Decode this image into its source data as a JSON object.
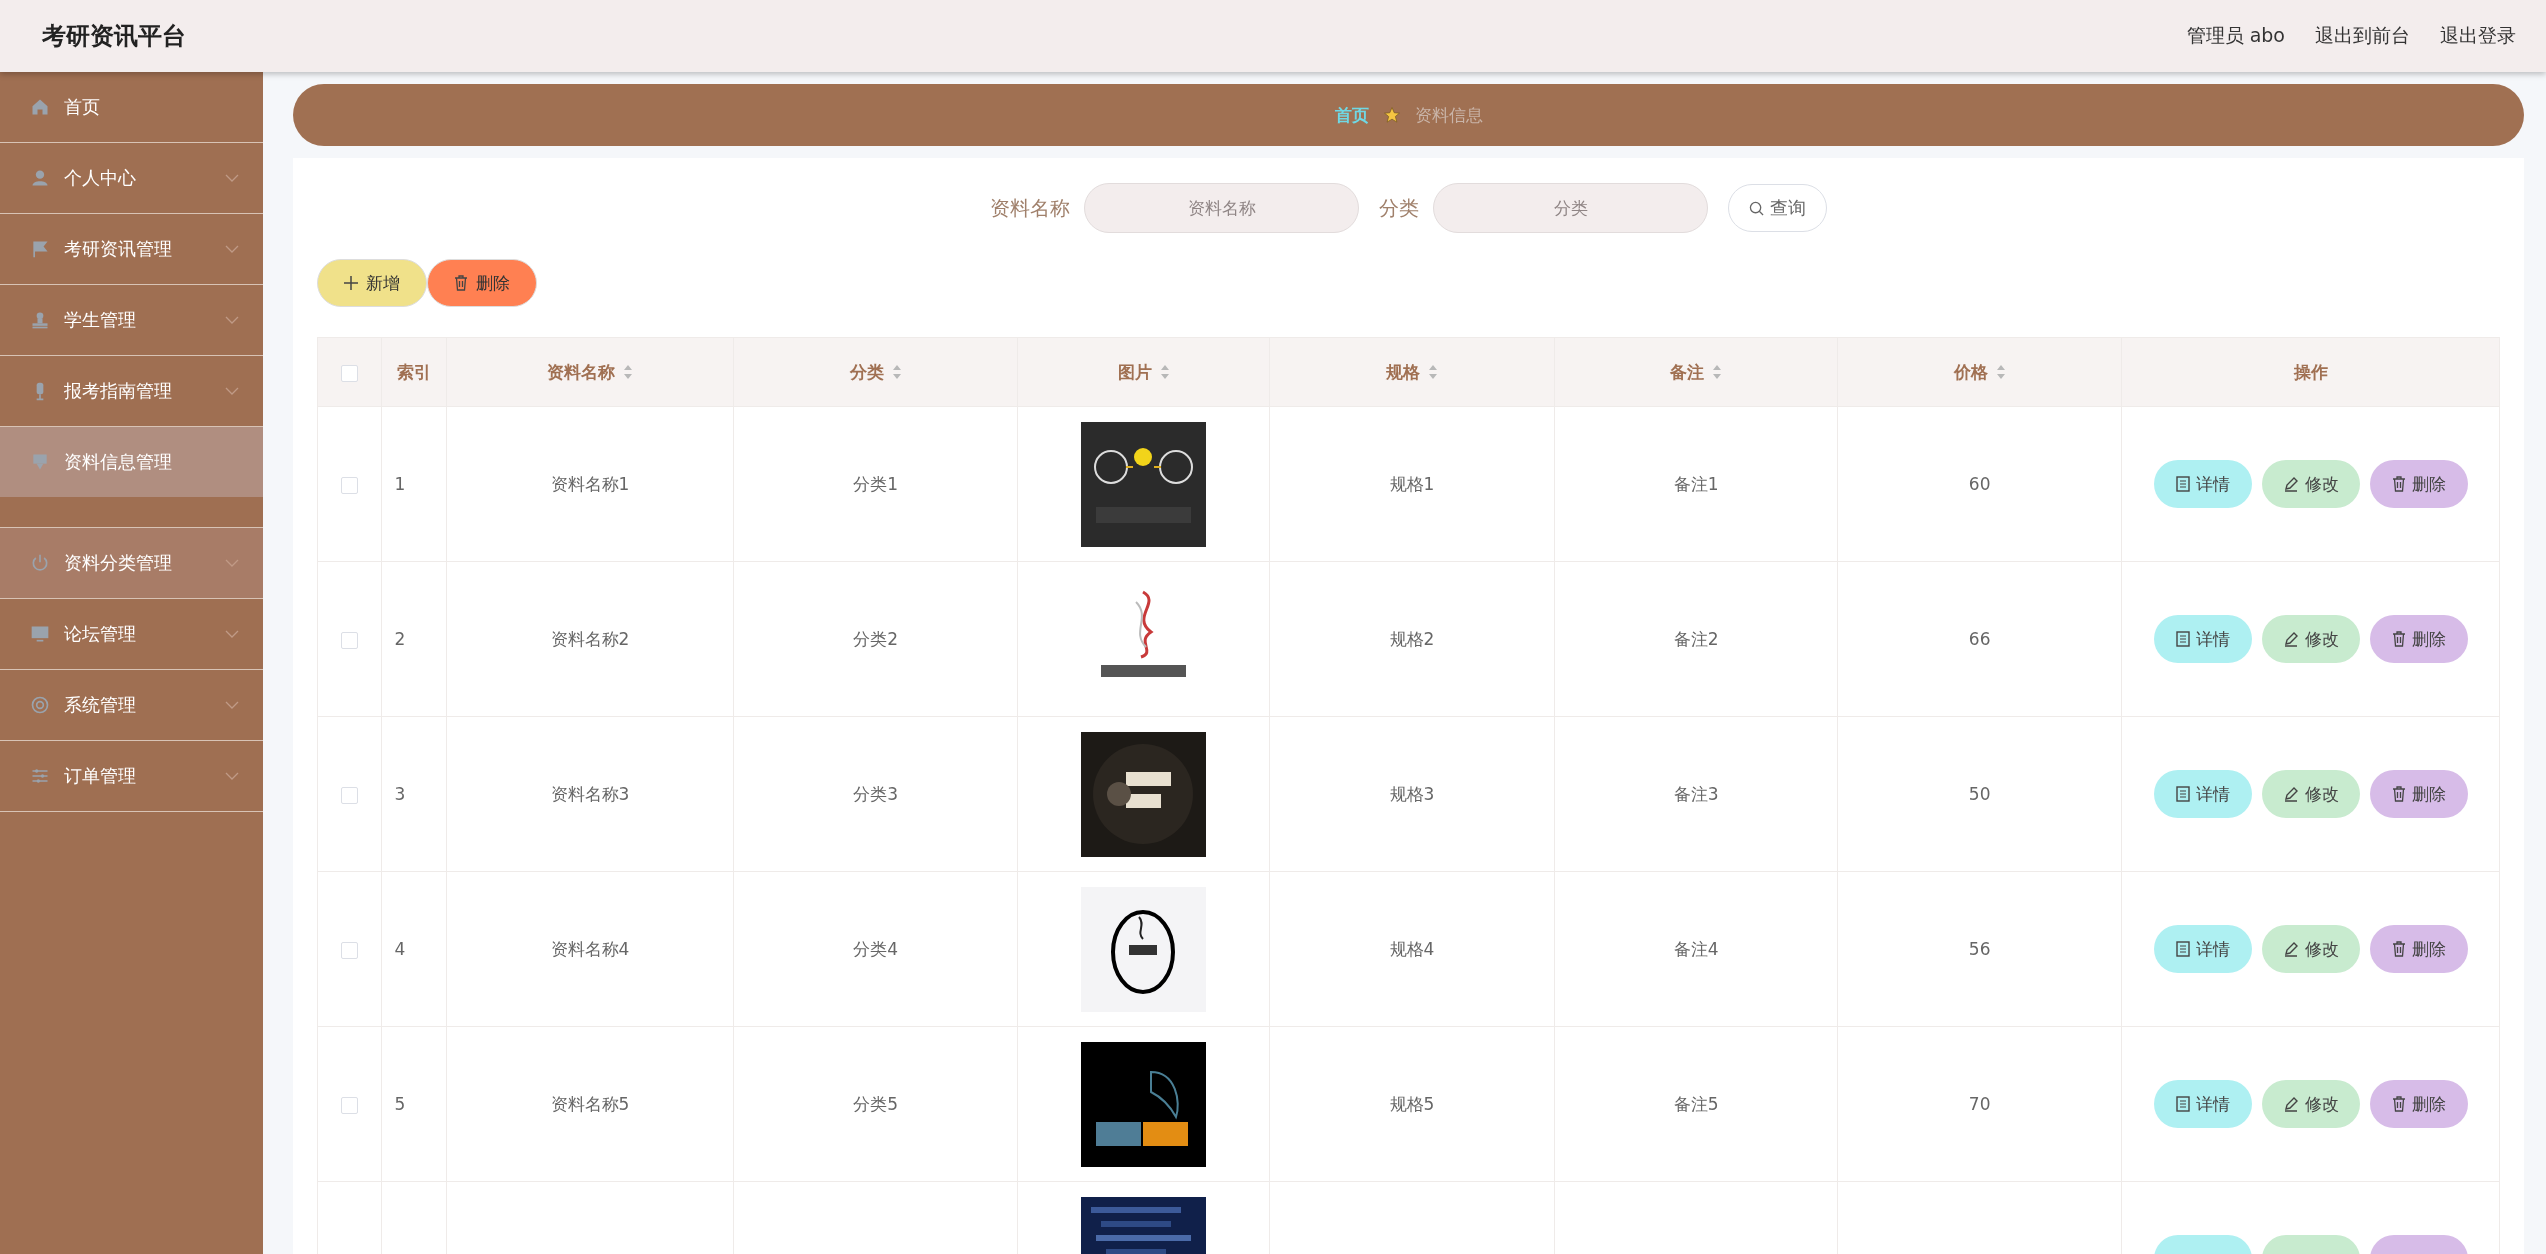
{
  "header": {
    "title": "考研资讯平台",
    "links": [
      {
        "label": "管理员 abo"
      },
      {
        "label": "退出到前台"
      },
      {
        "label": "退出登录"
      }
    ]
  },
  "sidebar": {
    "items": [
      {
        "label": "首页",
        "expandable": false,
        "selected": false,
        "hovered": false,
        "expanded": false
      },
      {
        "label": "个人中心",
        "expandable": true,
        "selected": false,
        "hovered": false,
        "expanded": false
      },
      {
        "label": "考研资讯管理",
        "expandable": true,
        "selected": false,
        "hovered": false,
        "expanded": false
      },
      {
        "label": "学生管理",
        "expandable": true,
        "selected": false,
        "hovered": false,
        "expanded": false
      },
      {
        "label": "报考指南管理",
        "expandable": true,
        "selected": false,
        "hovered": false,
        "expanded": false
      },
      {
        "label": "资料信息管理",
        "expandable": false,
        "selected": true,
        "hovered": false,
        "expanded": true
      },
      {
        "label": "资料分类管理",
        "expandable": true,
        "selected": false,
        "hovered": true,
        "expanded": false
      },
      {
        "label": "论坛管理",
        "expandable": true,
        "selected": false,
        "hovered": false,
        "expanded": false
      },
      {
        "label": "系统管理",
        "expandable": true,
        "selected": false,
        "hovered": false,
        "expanded": false
      },
      {
        "label": "订单管理",
        "expandable": true,
        "selected": false,
        "hovered": false,
        "expanded": false
      }
    ]
  },
  "breadcrumb": [
    {
      "label": "首页",
      "current": false
    },
    {
      "label": "资料信息",
      "current": true
    }
  ],
  "search": {
    "fields": [
      {
        "label": "资料名称",
        "placeholder": "资料名称"
      },
      {
        "label": "分类",
        "placeholder": "分类"
      }
    ],
    "button": "查询"
  },
  "toolbar": [
    {
      "kind": "add",
      "label": "新增"
    },
    {
      "kind": "delete",
      "label": "删除"
    }
  ],
  "table": {
    "select_all": {
      "checked": false
    },
    "columns": [
      {
        "label": "索引",
        "sortable": false
      },
      {
        "label": "资料名称",
        "sortable": true
      },
      {
        "label": "分类",
        "sortable": true
      },
      {
        "label": "图片",
        "sortable": true
      },
      {
        "label": "规格",
        "sortable": true
      },
      {
        "label": "备注",
        "sortable": true
      },
      {
        "label": "价格",
        "sortable": true
      },
      {
        "label": "操作",
        "sortable": false
      }
    ],
    "rows": [
      {
        "checked": false,
        "index": "1",
        "name": "资料名称1",
        "category": "分类1",
        "spec": "规格1",
        "note": "备注1",
        "price": "60",
        "actions": [
          {
            "kind": "detail",
            "label": "详情"
          },
          {
            "kind": "edit",
            "label": "修改"
          },
          {
            "kind": "delete",
            "label": "删除"
          }
        ]
      },
      {
        "checked": false,
        "index": "2",
        "name": "资料名称2",
        "category": "分类2",
        "spec": "规格2",
        "note": "备注2",
        "price": "66",
        "actions": [
          {
            "kind": "detail",
            "label": "详情"
          },
          {
            "kind": "edit",
            "label": "修改"
          },
          {
            "kind": "delete",
            "label": "删除"
          }
        ]
      },
      {
        "checked": false,
        "index": "3",
        "name": "资料名称3",
        "category": "分类3",
        "spec": "规格3",
        "note": "备注3",
        "price": "50",
        "actions": [
          {
            "kind": "detail",
            "label": "详情"
          },
          {
            "kind": "edit",
            "label": "修改"
          },
          {
            "kind": "delete",
            "label": "删除"
          }
        ]
      },
      {
        "checked": false,
        "index": "4",
        "name": "资料名称4",
        "category": "分类4",
        "spec": "规格4",
        "note": "备注4",
        "price": "56",
        "actions": [
          {
            "kind": "detail",
            "label": "详情"
          },
          {
            "kind": "edit",
            "label": "修改"
          },
          {
            "kind": "delete",
            "label": "删除"
          }
        ]
      },
      {
        "checked": false,
        "index": "5",
        "name": "资料名称5",
        "category": "分类5",
        "spec": "规格5",
        "note": "备注5",
        "price": "70",
        "actions": [
          {
            "kind": "detail",
            "label": "详情"
          },
          {
            "kind": "edit",
            "label": "修改"
          },
          {
            "kind": "delete",
            "label": "删除"
          }
        ]
      },
      {
        "actions": [
          {
            "kind": "detail"
          },
          {
            "kind": "edit"
          },
          {
            "kind": "delete"
          }
        ]
      }
    ]
  }
}
